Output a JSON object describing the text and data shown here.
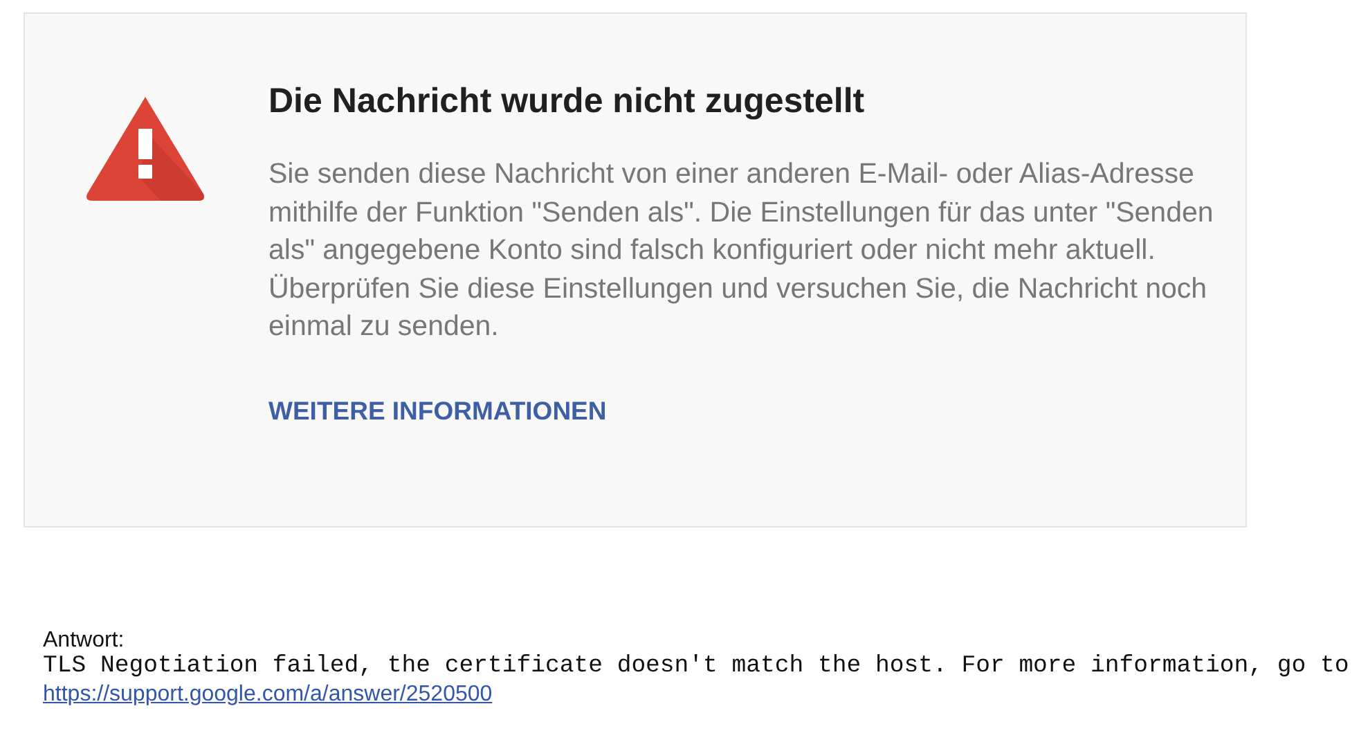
{
  "error_card": {
    "title": "Die Nachricht wurde nicht zugestellt",
    "message": "Sie senden diese Nachricht von einer anderen E-Mail- oder Alias-Adresse mithilfe der Funktion \"Senden als\". Die Einstellungen für das unter \"Senden als\" angegebene Konto sind falsch konfiguriert oder nicht mehr aktuell. Überprüfen Sie diese Einstellungen und versuchen Sie, die Nachricht noch einmal zu senden.",
    "link": "WEITERE INFORMATIONEN"
  },
  "response": {
    "label": "Antwort:",
    "text": "TLS Negotiation failed, the certificate doesn't match the host. For more information, go to",
    "link": "https://support.google.com/a/answer/2520500"
  }
}
